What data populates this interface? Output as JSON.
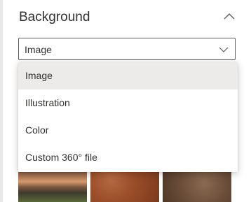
{
  "section": {
    "title": "Background"
  },
  "dropdown": {
    "selected": "Image",
    "options": [
      "Image",
      "Illustration",
      "Color",
      "Custom 360° file"
    ]
  },
  "colors": {
    "text": "#323130",
    "border": "#605e5c",
    "selected_bg": "#edebe9"
  },
  "icons": {
    "collapse": "chevron-up-icon",
    "dropdown": "chevron-down-icon"
  }
}
